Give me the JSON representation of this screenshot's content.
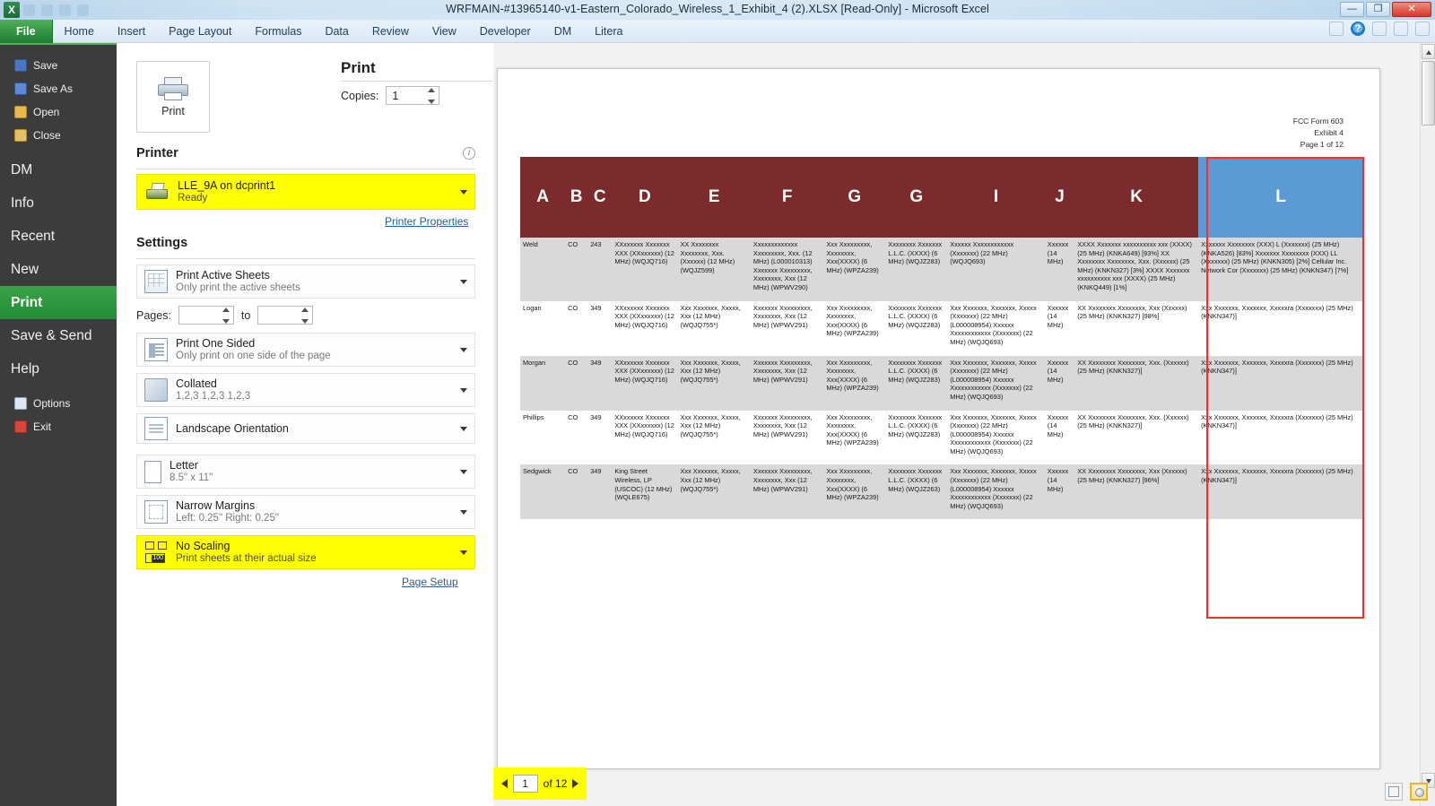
{
  "window": {
    "title": "WRFMAIN-#13965140-v1-Eastern_Colorado_Wireless_1_Exhibit_4 (2).XLSX  [Read-Only]  -  Microsoft Excel",
    "app_logo": "X",
    "minimize": "—",
    "restore": "❐",
    "close": "✕",
    "help_icon": "?"
  },
  "ribbon": {
    "tabs": [
      {
        "label": "File"
      },
      {
        "label": "Home"
      },
      {
        "label": "Insert"
      },
      {
        "label": "Page Layout"
      },
      {
        "label": "Formulas"
      },
      {
        "label": "Data"
      },
      {
        "label": "Review"
      },
      {
        "label": "View"
      },
      {
        "label": "Developer"
      },
      {
        "label": "DM"
      },
      {
        "label": "Litera"
      }
    ]
  },
  "backstage_nav": {
    "items": [
      {
        "label": "Save",
        "icon": "save-icon"
      },
      {
        "label": "Save As",
        "icon": "save-as-icon"
      },
      {
        "label": "Open",
        "icon": "open-folder-icon"
      },
      {
        "label": "Close",
        "icon": "close-folder-icon"
      },
      {
        "label": "DM",
        "icon": ""
      },
      {
        "label": "Info",
        "icon": ""
      },
      {
        "label": "Recent",
        "icon": ""
      },
      {
        "label": "New",
        "icon": ""
      },
      {
        "label": "Print",
        "icon": ""
      },
      {
        "label": "Save & Send",
        "icon": ""
      },
      {
        "label": "Help",
        "icon": ""
      },
      {
        "label": "Options",
        "icon": "options-icon"
      },
      {
        "label": "Exit",
        "icon": "exit-icon"
      }
    ],
    "active": "Print"
  },
  "print_pane": {
    "heading": "Print",
    "print_button_label": "Print",
    "copies_label": "Copies:",
    "copies_value": "1",
    "printer_section_title": "Printer",
    "printer_name": "LLE_9A on dcprint1",
    "printer_status": "Ready",
    "printer_properties_link": "Printer Properties",
    "settings_section_title": "Settings",
    "page_setup_link": "Page Setup",
    "pages_label": "Pages:",
    "pages_from": "",
    "pages_to_label": "to",
    "pages_to": "",
    "options": [
      {
        "main": "Print Active Sheets",
        "sub": "Only print the active sheets",
        "icon": "worksheet-icon",
        "highlighted": false
      },
      {
        "main": "Print One Sided",
        "sub": "Only print on one side of the page",
        "icon": "one-sided-icon",
        "highlighted": false
      },
      {
        "main": "Collated",
        "sub": "1,2,3   1,2,3   1,2,3",
        "icon": "collated-icon",
        "highlighted": false
      },
      {
        "main": "Landscape Orientation",
        "sub": "",
        "icon": "landscape-icon",
        "highlighted": false
      },
      {
        "main": "Letter",
        "sub": "8.5\" x 11\"",
        "icon": "paper-size-icon",
        "highlighted": false
      },
      {
        "main": "Narrow Margins",
        "sub": "Left:  0.25\"   Right:  0.25\"",
        "icon": "margins-icon",
        "highlighted": false
      },
      {
        "main": "No Scaling",
        "sub": "Print sheets at their actual size",
        "icon": "scaling-icon",
        "highlighted": true
      }
    ]
  },
  "preview": {
    "page_header_lines": [
      "FCC Form 603",
      "Exhibit 4",
      "Page 1 of 12"
    ],
    "column_headers": [
      "A",
      "B",
      "C",
      "D",
      "E",
      "F",
      "G",
      "G",
      "I",
      "J",
      "K",
      "L"
    ],
    "selected_column": "L",
    "selection_border_color": "#ff2a2a",
    "header_fill_color": "#7b2b2b",
    "selected_header_fill_color": "#5b9bd5",
    "rows": [
      {
        "shaded": true,
        "cells": [
          "Weld",
          "CO",
          "243",
          "XXxxxxxx Xxxxxxx XXX (XXxxxxxx) (12 MHz) (WQJQ716)",
          "XX Xxxxxxxx Xxxxxxxx, Xxx. (Xxxxxx) (12 MHz) (WQJZ599)",
          "Xxxxxxxxxxxxx Xxxxxxxxx, Xxx. (12 MHz) (L000010313) Xxxxxxx Xxxxxxxxx, Xxxxxxxx, Xxx (12 MHz) (WPWV290)",
          "Xxx Xxxxxxxxx, Xxxxxxxx, Xxx(XXXX) (6 MHz) (WPZA239)",
          "Xxxxxxxx Xxxxxxx L.L.C. (XXXX) (6 MHz) (WQJZ283)",
          "Xxxxxx Xxxxxxxxxxxx (Xxxxxxx) (22 MHz) (WQJQ693)",
          "Xxxxxx (14 MHz)",
          "XXXX Xxxxxxx xxxxxxxxxx xxx (XXXX) (25 MHz) (KNKA649) [93%] XX Xxxxxxxx Xxxxxxxx, Xxx. (Xxxxxx) (25 MHz) (KNKN327) [3%] XXXX Xxxxxxx xxxxxxxxxx xxx (XXXX) (25 MHz) (KNKQ449) [1%]",
          "Xxxxxxx Xxxxxxxx (XXX) L (Xxxxxxx) (25 MHz) (KNKA526) [83%] Xxxxxxx Xxxxxxxx (XXX) LL (Xxxxxxx) (25 MHz) (KNKN305) [2%] Cellular Inc. Network Cor (Xxxxxxx) (25 MHz) (KNKN347) [7%]"
        ]
      },
      {
        "shaded": false,
        "cells": [
          "Logan",
          "CO",
          "349",
          "XXxxxxxx Xxxxxxx XXX (XXxxxxxx) (12 MHz) (WQJQ716)",
          "Xxx Xxxxxxx, Xxxxx, Xxx (12 MHz) (WQJQ755*)",
          "Xxxxxxx Xxxxxxxxx, Xxxxxxxx, Xxx (12 MHz) (WPWV291)",
          "Xxx Xxxxxxxxx, Xxxxxxxx, Xxx(XXXX) (6 MHz) (WPZA239)",
          "Xxxxxxxx Xxxxxxx L.L.C. (XXXX) (6 MHz) (WQJZ283)",
          "Xxx Xxxxxxx, Xxxxxxx, Xxxxx (Xxxxxxx) (22 MHz) (L000008954) Xxxxxx Xxxxxxxxxxxx (Xxxxxxx) (22 MHz) (WQJQ693)",
          "Xxxxxx (14 MHz)",
          "XX Xxxxxxxx Xxxxxxxx, Xxx (Xxxxxx) (25 MHz) (KNKN327) [98%]",
          "Xxx Xxxxxxx, Xxxxxxx, Xxxxxra (Xxxxxxx) (25 MHz) (KNKN347)]"
        ]
      },
      {
        "shaded": true,
        "cells": [
          "Morgan",
          "CO",
          "349",
          "XXxxxxxx Xxxxxxx XXX (XXxxxxxx) (12 MHz) (WQJQ716)",
          "Xxx Xxxxxxx, Xxxxx, Xxx (12 MHz) (WQJQ755*)",
          "Xxxxxxx Xxxxxxxxx, Xxxxxxxx, Xxx (12 MHz) (WPWV291)",
          "Xxx Xxxxxxxxx, Xxxxxxxx, Xxx(XXXX) (6 MHz) (WPZA239)",
          "Xxxxxxxx Xxxxxxx L.L.C. (XXXX) (6 MHz) (WQJZ283)",
          "Xxx Xxxxxxx, Xxxxxxx, Xxxxx (Xxxxxxx) (22 MHz) (L000008954) Xxxxxx Xxxxxxxxxxxx (Xxxxxxx) (22 MHz) (WQJQ693)",
          "Xxxxxx (14 MHz)",
          "XX Xxxxxxxx Xxxxxxxx, Xxx. (Xxxxxx) (25 MHz) (KNKN327)]",
          "Xxx Xxxxxxx, Xxxxxxx, Xxxxxra (Xxxxxxx) (25 MHz) (KNKN347)]"
        ]
      },
      {
        "shaded": false,
        "cells": [
          "Phillips",
          "CO",
          "349",
          "XXxxxxxx Xxxxxxx XXX (XXxxxxxx) (12 MHz) (WQJQ716)",
          "Xxx Xxxxxxx, Xxxxx, Xxx (12 MHz) (WQJQ755*)",
          "Xxxxxxx Xxxxxxxxx, Xxxxxxxx, Xxx (12 MHz) (WPWV291)",
          "Xxx Xxxxxxxxx, Xxxxxxxx, Xxx(XXXX) (6 MHz) (WPZA239)",
          "Xxxxxxxx Xxxxxxx L.L.C. (XXXX) (6 MHz) (WQJZ283)",
          "Xxx Xxxxxxx, Xxxxxxx, Xxxxx (Xxxxxxx) (22 MHz) (L000008954) Xxxxxx Xxxxxxxxxxxx (Xxxxxxx) (22 MHz) (WQJQ693)",
          "Xxxxxx (14 MHz)",
          "XX Xxxxxxxx Xxxxxxxx, Xxx. (Xxxxxx) (25 MHz) (KNKN327)]",
          "Xxx Xxxxxxx, Xxxxxxx, Xxxxxra (Xxxxxxx) (25 MHz) (KNKN347)]"
        ]
      },
      {
        "shaded": true,
        "cells": [
          "Sedgwick",
          "CO",
          "349",
          "King Street Wireless, LP (USCOC) (12 MHz) (WQLE675)",
          "Xxx Xxxxxxx, Xxxxx, Xxx (12 MHz) (WQJQ755*)",
          "Xxxxxxx Xxxxxxxxx, Xxxxxxxx, Xxx (12 MHz) (WPWV291)",
          "Xxx Xxxxxxxxx, Xxxxxxxx, Xxx(XXXX) (6 MHz) (WPZA239)",
          "Xxxxxxxx Xxxxxxx L.L.C. (XXXX) (6 MHz) (WQJZ263)",
          "Xxx Xxxxxxx, Xxxxxxx, Xxxxx (Xxxxxxx) (22 MHz) (L000008954) Xxxxxx Xxxxxxxxxxxx (Xxxxxxx) (22 MHz) (WQJQ693)",
          "Xxxxxx (14 MHz)",
          "XX Xxxxxxxx Xxxxxxxx, Xxx (Xxxxxx) (25 MHz) (KNKN327) [96%]",
          "Xxx Xxxxxxx, Xxxxxxx, Xxxxxra (Xxxxxxx) (25 MHz) (KNKN347)]"
        ]
      }
    ]
  },
  "status": {
    "page_number": "1",
    "page_total": "of 12",
    "prev_label": "◀",
    "next_label": "▶"
  }
}
